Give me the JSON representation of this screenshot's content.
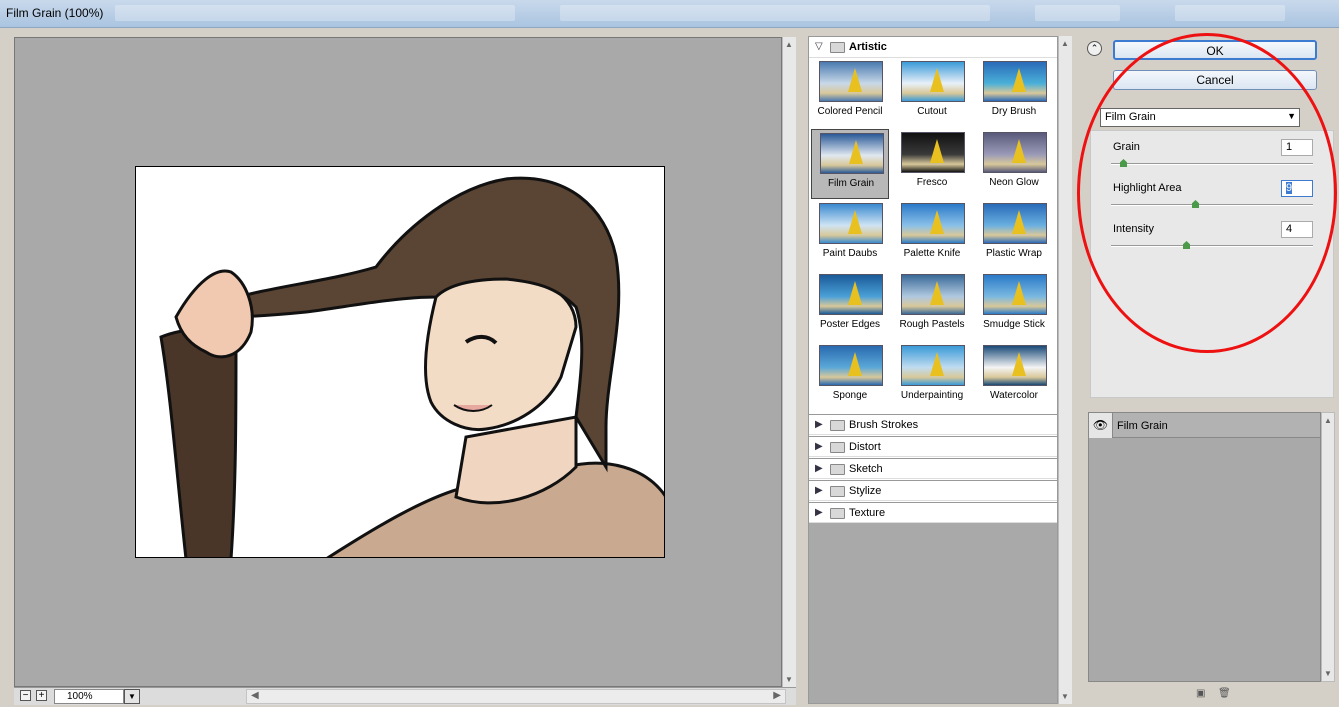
{
  "window": {
    "title": "Film Grain (100%)"
  },
  "preview": {
    "zoom": "100%",
    "zoom_out": "−",
    "zoom_in": "+"
  },
  "gallery": {
    "category": "Artistic",
    "filters": [
      {
        "label": "Colored Pencil"
      },
      {
        "label": "Cutout"
      },
      {
        "label": "Dry Brush"
      },
      {
        "label": "Film Grain"
      },
      {
        "label": "Fresco"
      },
      {
        "label": "Neon Glow"
      },
      {
        "label": "Paint Daubs"
      },
      {
        "label": "Palette Knife"
      },
      {
        "label": "Plastic Wrap"
      },
      {
        "label": "Poster Edges"
      },
      {
        "label": "Rough Pastels"
      },
      {
        "label": "Smudge Stick"
      },
      {
        "label": "Sponge"
      },
      {
        "label": "Underpainting"
      },
      {
        "label": "Watercolor"
      }
    ],
    "selected_index": 3,
    "categories": [
      {
        "label": "Brush Strokes"
      },
      {
        "label": "Distort"
      },
      {
        "label": "Sketch"
      },
      {
        "label": "Stylize"
      },
      {
        "label": "Texture"
      }
    ]
  },
  "controls": {
    "ok": "OK",
    "cancel": "Cancel",
    "filter_select": "Film Grain",
    "params": [
      {
        "label": "Grain",
        "value": "1",
        "level": 0.05
      },
      {
        "label": "Highlight Area",
        "value": "9",
        "level": 0.45
      },
      {
        "label": "Intensity",
        "value": "4",
        "level": 0.4
      }
    ]
  },
  "layers": {
    "effect_name": "Film Grain"
  },
  "colors": {
    "annotation": "#e11111",
    "ok_focus": "#3d7bd1"
  }
}
